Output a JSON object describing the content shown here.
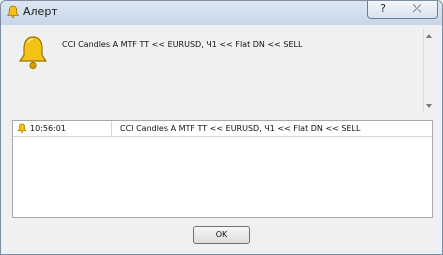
{
  "window": {
    "title": "Алерт",
    "help_glyph": "?",
    "close_glyph": "⤫"
  },
  "alert": {
    "icon": "bell-icon",
    "message": "CCI Candles A MTF TT  << EURUSD, Ч1  << Flat DN << SELL"
  },
  "list": {
    "rows": [
      {
        "time": "10:56:01",
        "message": "CCI Candles A MTF TT  << EURUSD, Ч1  << Flat DN << SELL"
      }
    ]
  },
  "buttons": {
    "ok_label": "OK"
  },
  "colors": {
    "bell": "#f0b400",
    "bell_outline": "#8a6a00",
    "frame": "#7d8ea3"
  }
}
